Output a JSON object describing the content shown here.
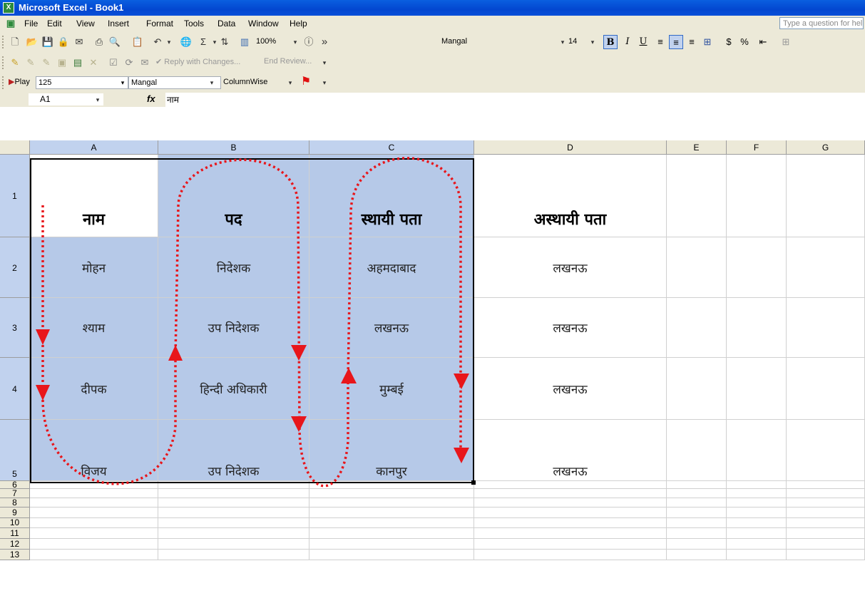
{
  "window": {
    "title": "Microsoft Excel - Book1"
  },
  "menubar": {
    "items": [
      "File",
      "Edit",
      "View",
      "Insert",
      "Format",
      "Tools",
      "Data",
      "Window",
      "Help"
    ],
    "ask_placeholder": "Type a question for help"
  },
  "toolbar_standard": {
    "zoom": "100%",
    "font": "Mangal",
    "font_size": "14",
    "bold_label": "B",
    "italic_label": "I",
    "underline_label": "U",
    "currency_label": "$",
    "percent_label": "%"
  },
  "toolbar_review": {
    "reply_label": "Reply with Changes...",
    "end_review_label": "End Review..."
  },
  "toolbar_extra": {
    "play_label": "Play",
    "play_value": "125",
    "font": "Mangal",
    "mode": "ColumnWise"
  },
  "formula_bar": {
    "cell_ref": "A1",
    "fx_label": "fx",
    "content": "नाम"
  },
  "columns": [
    "A",
    "B",
    "C",
    "D",
    "E",
    "F",
    "G"
  ],
  "rows": [
    "1",
    "2",
    "3",
    "4",
    "5",
    "6",
    "7",
    "8",
    "9",
    "10",
    "11",
    "12",
    "13"
  ],
  "table": {
    "headers": [
      "नाम",
      "पद",
      "स्थायी पता",
      "अस्थायी पता"
    ],
    "rows": [
      [
        "मोहन",
        "निदेशक",
        "अहमदाबाद",
        "लखनऊ"
      ],
      [
        "श्याम",
        "उप निदेशक",
        "लखनऊ",
        "लखनऊ"
      ],
      [
        "दीपक",
        "हिन्दी अधिकारी",
        "मुम्बई",
        "लखनऊ"
      ],
      [
        "विजय",
        "उप निदेशक",
        "कानपुर",
        "लखनऊ"
      ]
    ]
  },
  "colors": {
    "selection": "#b6c9e8",
    "arrow": "#e8161b",
    "titlebar": "#0347d0"
  }
}
